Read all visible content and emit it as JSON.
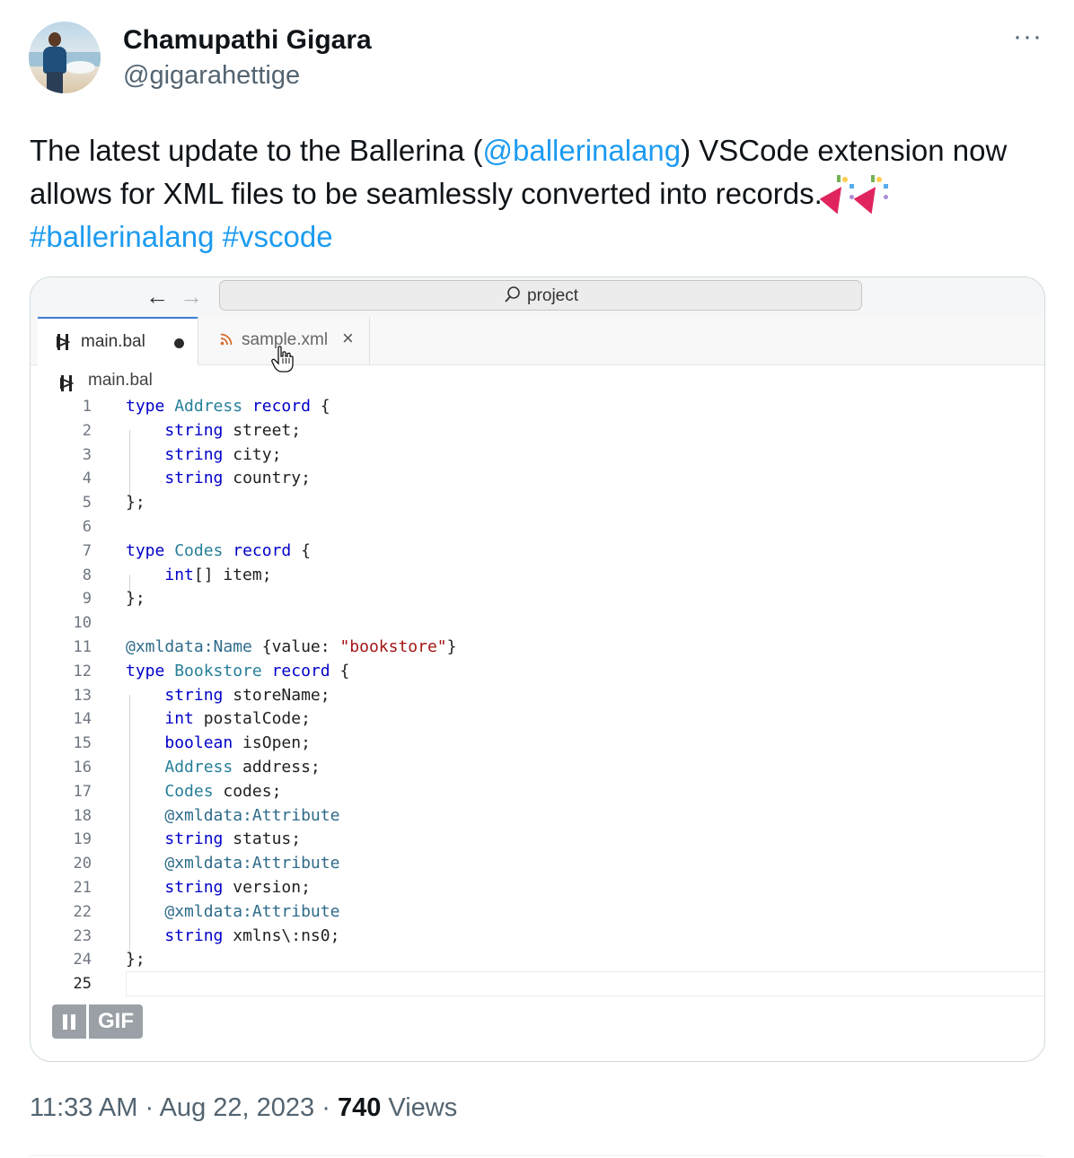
{
  "author": {
    "name": "Chamupathi Gigara",
    "handle": "@gigarahettige"
  },
  "tweet": {
    "text_before": "The latest update to the Ballerina (",
    "mention": "@ballerinalang",
    "text_after": ") VSCode extension now allows for XML files to be seamlessly converted into records.",
    "hashtag_1": "#ballerinalang",
    "hashtag_2": "#vscode",
    "emoji": "party-popper"
  },
  "more_label": "···",
  "media": {
    "type": "GIF",
    "gif_label": "GIF",
    "vscode": {
      "nav_back": "←",
      "nav_forward": "→",
      "command_center": "project",
      "tabs": [
        {
          "label": "main.bal",
          "icon": "ballerina-icon",
          "dirty": true,
          "active": true
        },
        {
          "label": "sample.xml",
          "icon": "rss-icon",
          "close": "×",
          "active": false
        }
      ],
      "breadcrumb": "main.bal",
      "active_line": 25,
      "lines": [
        "1",
        "2",
        "3",
        "4",
        "5",
        "6",
        "7",
        "8",
        "9",
        "10",
        "11",
        "12",
        "13",
        "14",
        "15",
        "16",
        "17",
        "18",
        "19",
        "20",
        "21",
        "22",
        "23",
        "24",
        "25"
      ]
    }
  },
  "meta": {
    "time": "11:33 AM",
    "separator": "·",
    "date": "Aug 22, 2023",
    "views_count": "740",
    "views_label": "Views"
  },
  "colors": {
    "link": "#1d9bf0",
    "keyword": "#0000c8",
    "type": "#267f99",
    "string": "#a31515"
  }
}
